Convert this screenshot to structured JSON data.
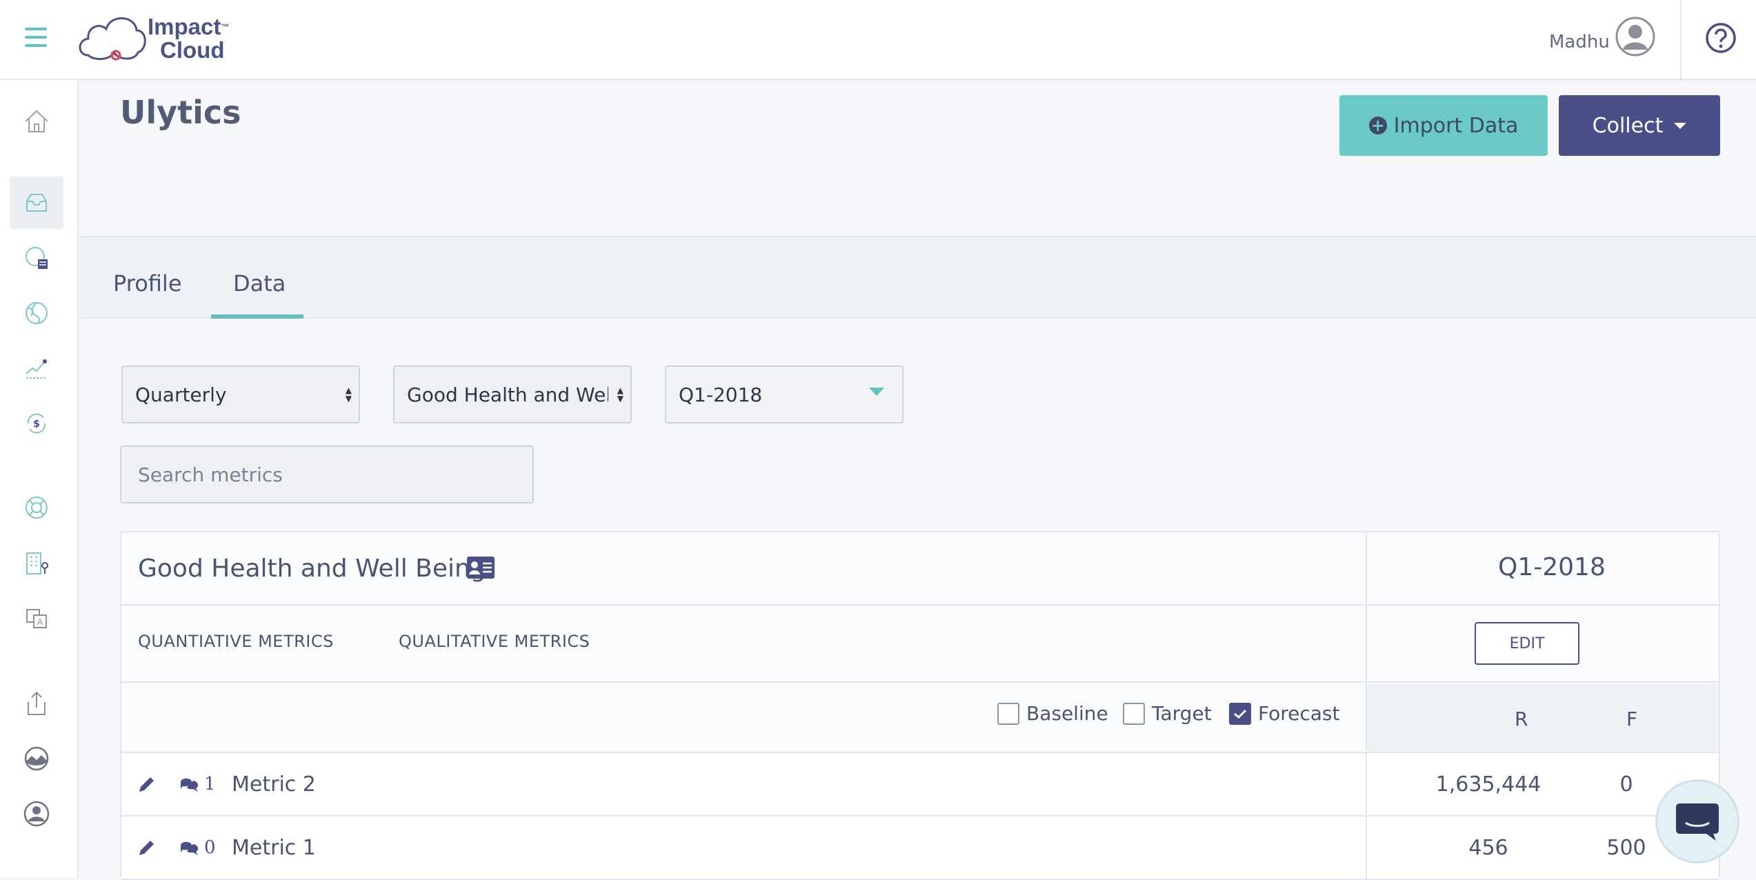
{
  "brand": {
    "line1": "Impact",
    "line2": "Cloud",
    "tm": "™"
  },
  "user": {
    "name": "Madhu"
  },
  "page": {
    "title": "Ulytics"
  },
  "actions": {
    "import_label": "Import Data",
    "collect_label": "Collect"
  },
  "tabs": [
    {
      "label": "Profile"
    },
    {
      "label": "Data"
    }
  ],
  "filters": {
    "frequency": "Quarterly",
    "goal": "Good Health and Well Being",
    "period": "Q1-2018",
    "search_placeholder": "Search metrics"
  },
  "table": {
    "goal_title": "Good Health and Well Being",
    "period_header": "Q1-2018",
    "metric_types": [
      "QUANTIATIVE METRICS",
      "QUALITATIVE METRICS"
    ],
    "edit_label": "EDIT",
    "checkboxes": [
      {
        "label": "Baseline",
        "checked": false
      },
      {
        "label": "Target",
        "checked": false
      },
      {
        "label": "Forecast",
        "checked": true
      }
    ],
    "columns": [
      "R",
      "F"
    ],
    "rows": [
      {
        "name": "Metric 2",
        "comments": "1",
        "r": "1,635,444",
        "f": "0"
      },
      {
        "name": "Metric 1",
        "comments": "0",
        "r": "456",
        "f": "500"
      }
    ]
  },
  "colors": {
    "teal": "#6ccac6",
    "indigo": "#4b4f88",
    "text": "#4a5470"
  }
}
